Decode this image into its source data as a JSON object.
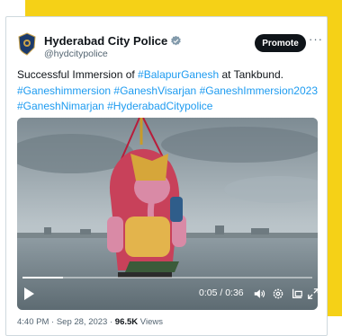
{
  "post": {
    "account_name": "Hyderabad City Police",
    "handle": "@hydcitypolice",
    "promote_label": "Promote",
    "more_label": "···",
    "text_lead": "Successful Immersion of ",
    "hashtag_1": "#BalapurGanesh",
    "text_mid": " at Tankbund. ",
    "hashtag_2": "#Ganeshimmersion",
    "hashtag_3": "#GaneshVisarjan",
    "hashtag_4": "#GaneshImmersion2023",
    "hashtag_5": "#GaneshNimarjan",
    "hashtag_6": "#HyderabadCitypolice",
    "timestamp": "4:40 PM · Sep 28, 2023 · ",
    "views_count": "96.5K",
    "views_label": " Views"
  },
  "video": {
    "time_display": "0:05 / 0:36",
    "progress_fraction": 0.14
  },
  "icons": {
    "verified": "verified-badge-icon",
    "play": "play-icon",
    "volume": "volume-icon",
    "settings": "settings-gear-icon",
    "pip": "picture-in-picture-icon",
    "fullscreen": "fullscreen-icon"
  },
  "colors": {
    "accent_blue": "#1d9bf0",
    "background_yellow": "#f5d117",
    "text_primary": "#0f1419",
    "text_secondary": "#536471"
  }
}
